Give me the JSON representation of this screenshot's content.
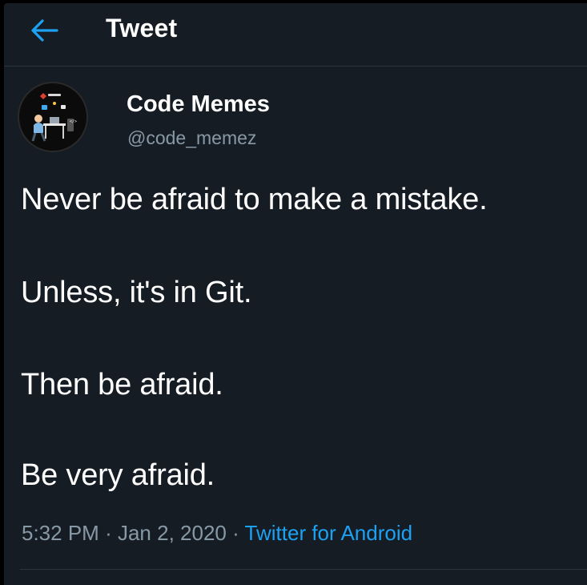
{
  "header": {
    "back_icon": "arrow-left-icon",
    "title": "Tweet"
  },
  "author": {
    "name": "Code Memes",
    "handle": "@code_memez",
    "avatar_icon": "developer-at-desk-avatar"
  },
  "tweet": {
    "lines": [
      "Never be afraid to make a mistake.",
      "Unless, it's in Git.",
      "Then be afraid.",
      "Be very afraid."
    ],
    "time": "5:32 PM",
    "separator": "·",
    "date": "Jan 2, 2020",
    "source": "Twitter for Android"
  },
  "colors": {
    "background": "#161c24",
    "accent": "#1da1f2",
    "secondary_text": "#8899a6"
  }
}
